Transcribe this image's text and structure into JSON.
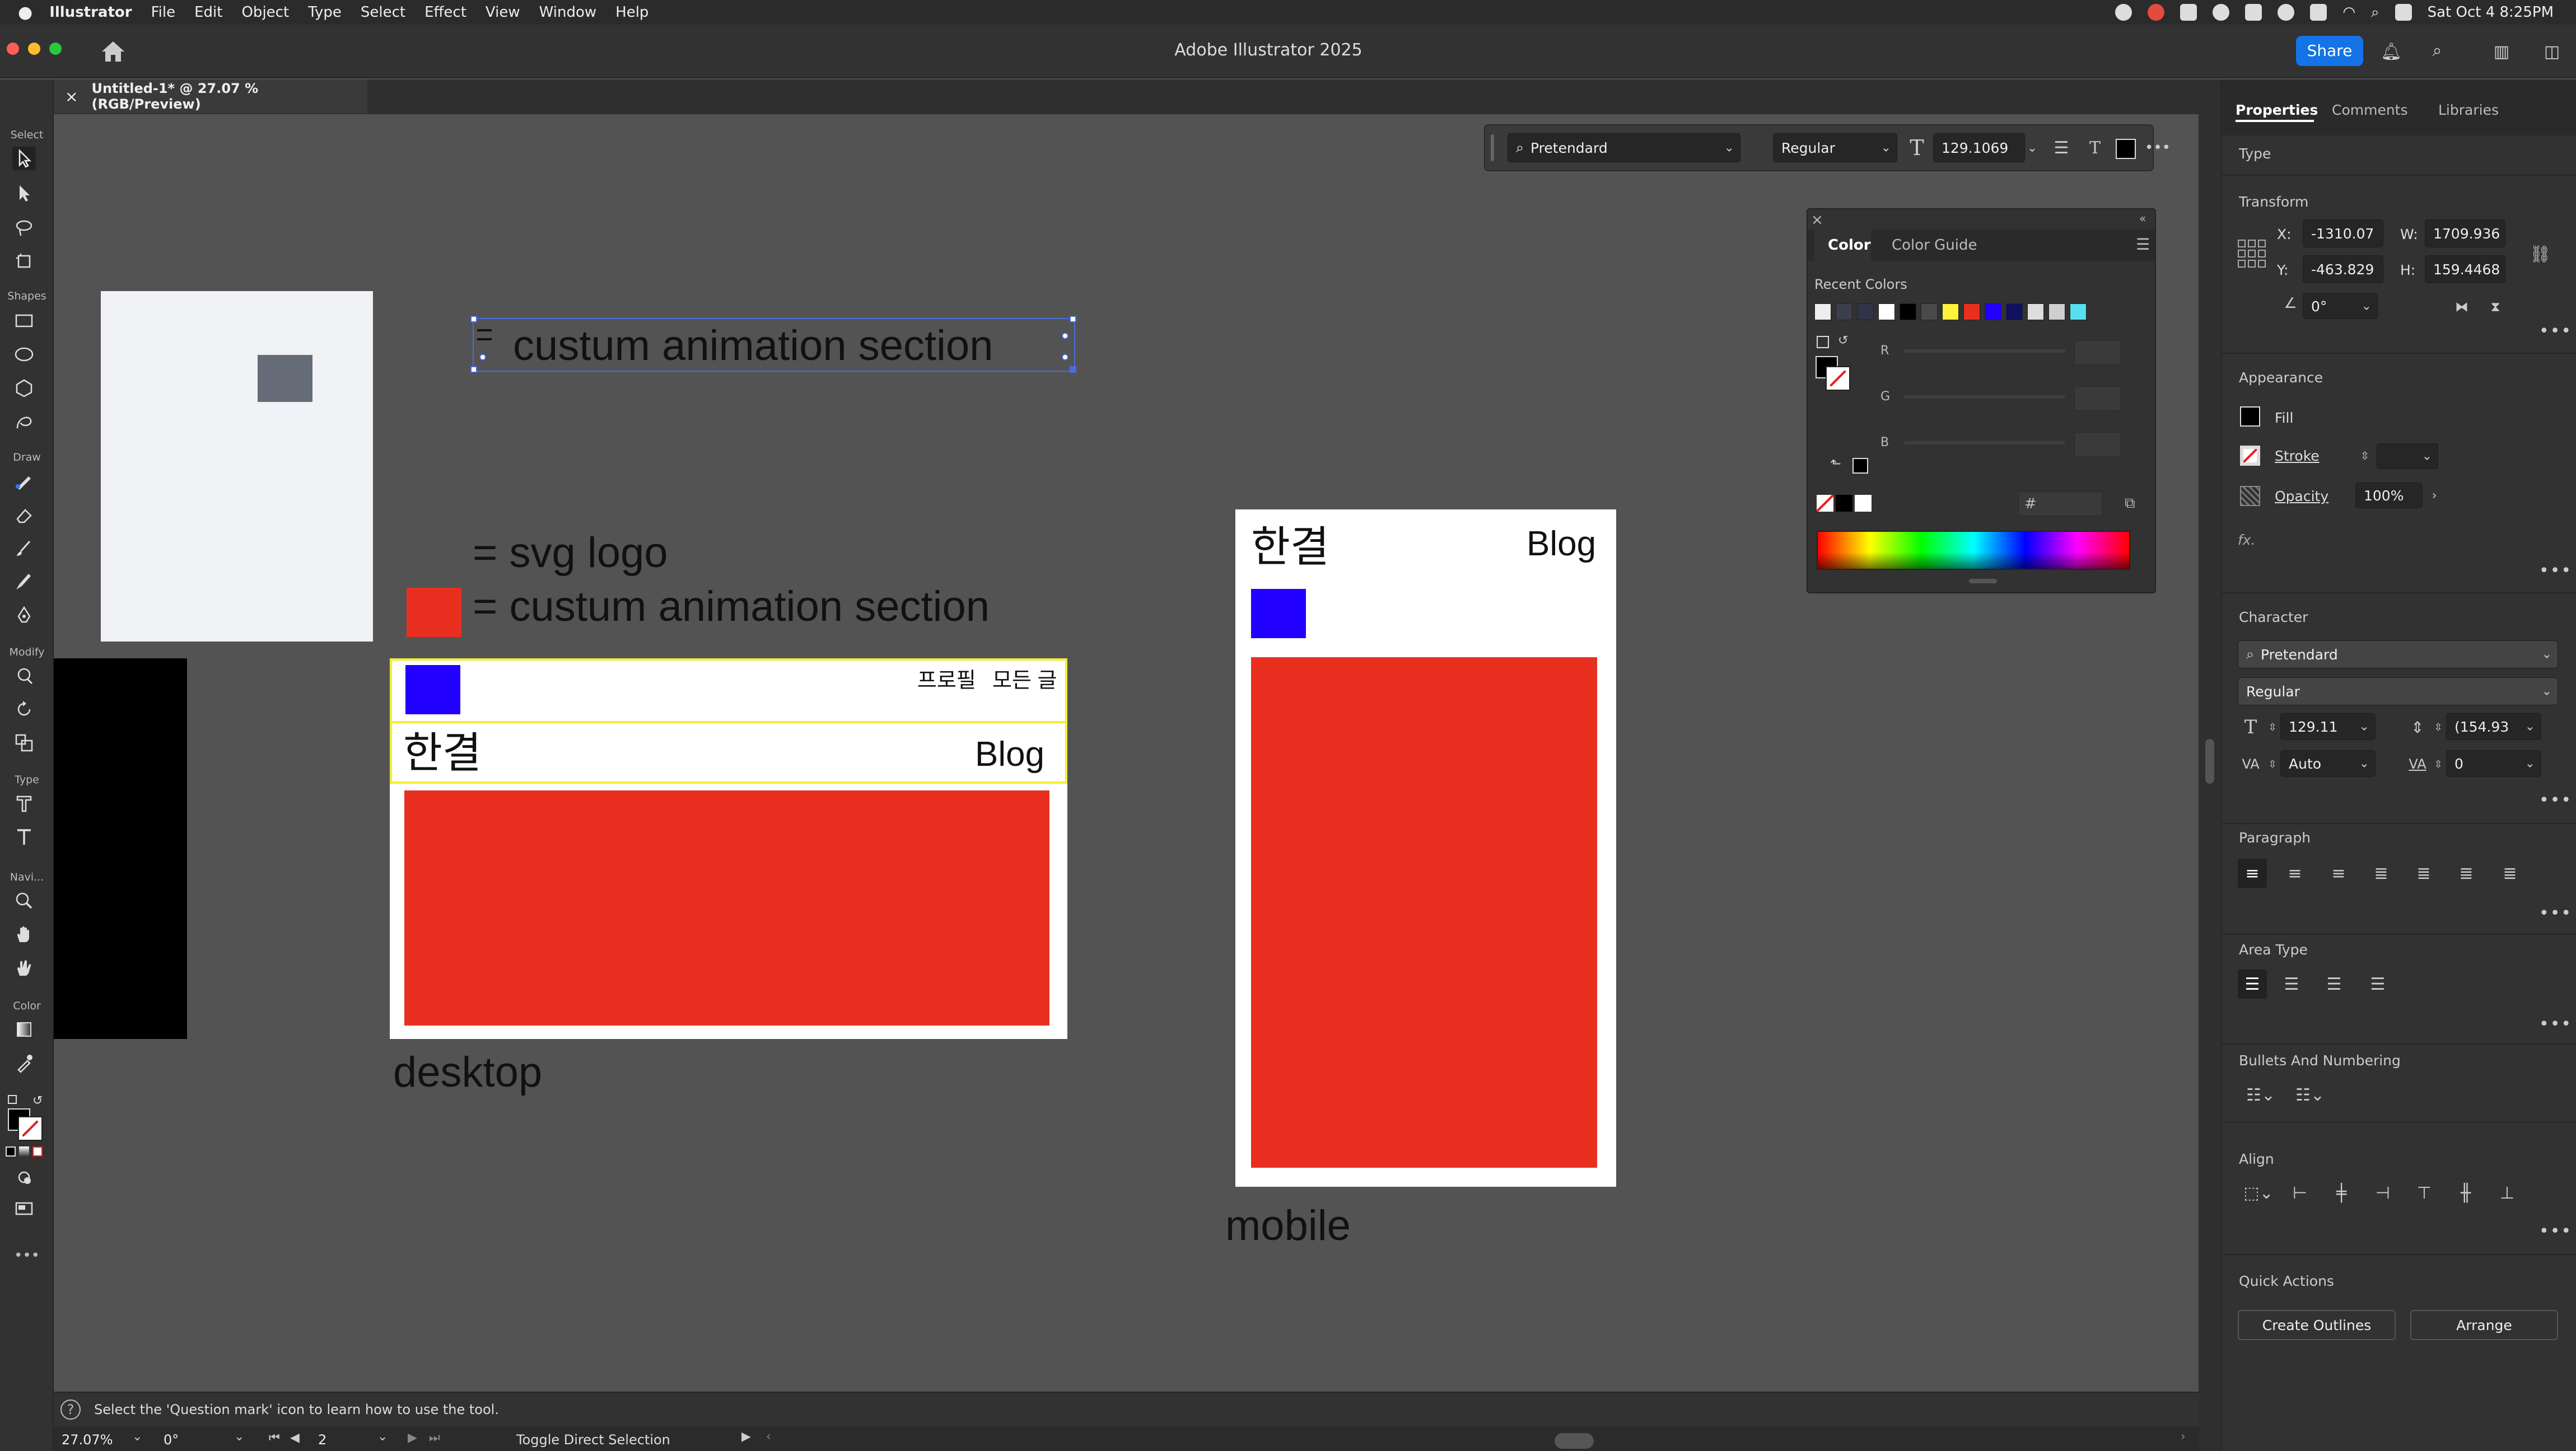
{
  "menubar": {
    "apple": "",
    "app_name": "Illustrator",
    "menus": [
      "File",
      "Edit",
      "Object",
      "Type",
      "Select",
      "Effect",
      "View",
      "Window",
      "Help"
    ],
    "clock": "Sat Oct 4  8:25PM"
  },
  "window": {
    "title": "Adobe Illustrator 2025",
    "share_label": "Share"
  },
  "document_tab": {
    "label": "Untitled-1* @ 27.07 % (RGB/Preview)"
  },
  "toolbar": {
    "groups": [
      "Select",
      "Shapes",
      "Draw",
      "Modify",
      "Type",
      "Navi...",
      "Color"
    ],
    "more": "•••"
  },
  "control_bar": {
    "font_family": "Pretendard",
    "font_style": "Regular",
    "font_size": "129.1069",
    "more": "•••"
  },
  "canvas": {
    "selected_text": "custum animation section",
    "legend_svg_logo": "= svg logo",
    "legend_animation": "= custum animation section",
    "desktop_nav_link1": "프로필",
    "desktop_nav_link2": "모든 글",
    "desktop_brand": "한결",
    "desktop_blog": "Blog",
    "desktop_label": "desktop",
    "mobile_brand": "한결",
    "mobile_blog": "Blog",
    "mobile_label": "mobile",
    "colors": {
      "red": "#e93020",
      "blue": "#2200ff",
      "gray_square": "#656b77",
      "yellow_outline": "#f2ee35"
    }
  },
  "color_panel": {
    "tab_color": "Color",
    "tab_guide": "Color Guide",
    "recent_colors_label": "Recent Colors",
    "recent_colors": [
      "#eeeeee",
      "#3a3f4b",
      "#2f3548",
      "#ffffff",
      "#000000",
      "#4a4a4a",
      "#fff23a",
      "#e93020",
      "#2200ff",
      "#101060",
      "#dddddd",
      "#cfcfcf",
      "#56e0ef"
    ],
    "channels": [
      "R",
      "G",
      "B"
    ],
    "hex_label": "#"
  },
  "properties": {
    "tabs": [
      "Properties",
      "Comments",
      "Libraries"
    ],
    "type_label": "Type",
    "transform_label": "Transform",
    "x_label": "X:",
    "x_value": "-1310.07",
    "y_label": "Y:",
    "y_value": "-463.829",
    "w_label": "W:",
    "w_value": "1709.936",
    "h_label": "H:",
    "h_value": "159.4468",
    "rotate_value": "0°",
    "appearance_label": "Appearance",
    "fill_label": "Fill",
    "stroke_label": "Stroke",
    "opacity_label": "Opacity",
    "opacity_value": "100%",
    "fx_label": "fx.",
    "character_label": "Character",
    "char_font": "Pretendard",
    "char_style": "Regular",
    "char_size": "129.11",
    "char_leading": "(154.93",
    "char_kerning": "Auto",
    "char_tracking": "0",
    "paragraph_label": "Paragraph",
    "area_type_label": "Area Type",
    "bullets_label": "Bullets And Numbering",
    "align_label": "Align",
    "quick_actions_label": "Quick Actions",
    "create_outlines": "Create Outlines",
    "arrange": "Arrange",
    "more": "•••"
  },
  "status_bar": {
    "hint": "Select the 'Question mark' icon to learn how to use the tool.",
    "zoom": "27.07%",
    "rotation": "0°",
    "artboard": "2",
    "tool_status": "Toggle Direct Selection"
  }
}
